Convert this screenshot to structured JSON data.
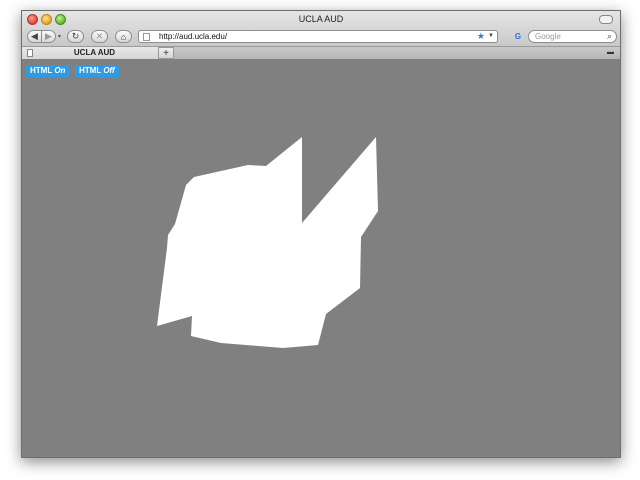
{
  "window": {
    "title": "UCLA AUD"
  },
  "toolbar": {
    "back_icon": "arrow-left-icon",
    "forward_icon": "arrow-right-icon",
    "reload_icon": "reload-icon",
    "stop_icon": "stop-icon",
    "home_icon": "home-icon",
    "url": "http://aud.ucla.edu/",
    "search_engine": "G",
    "search_placeholder": "Google"
  },
  "tabs": [
    {
      "label": "UCLA AUD"
    }
  ],
  "page": {
    "html_on": {
      "prefix": "HTML",
      "state": "On"
    },
    "html_off": {
      "prefix": "HTML",
      "state": "Off"
    },
    "shape_color": "#ffffff",
    "background_color": "#808080"
  }
}
